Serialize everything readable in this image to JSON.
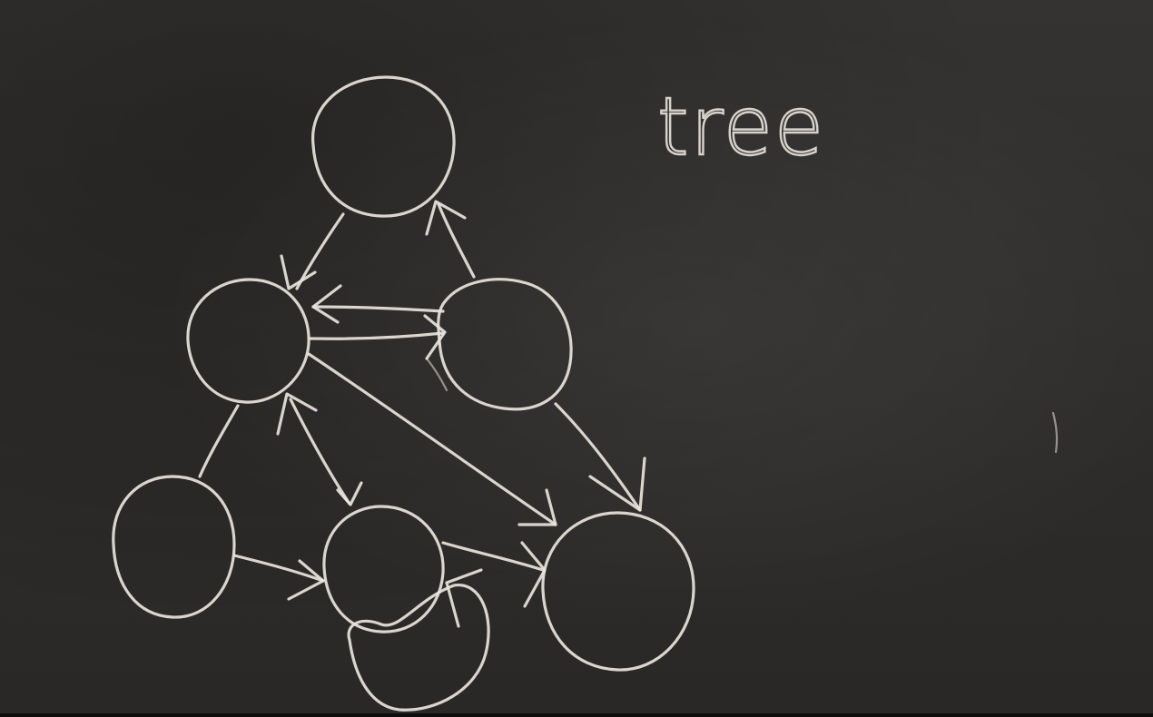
{
  "diagram": {
    "label": "tree",
    "chalk_color": "#e9e4dc",
    "board_color": "#2f2d2b",
    "nodes": [
      {
        "id": "n1"
      },
      {
        "id": "n2"
      },
      {
        "id": "n3"
      },
      {
        "id": "n4"
      },
      {
        "id": "n5"
      },
      {
        "id": "n6"
      },
      {
        "id": "n7"
      }
    ],
    "edges": [
      {
        "from": "n1",
        "to": "n2",
        "arrow": "to"
      },
      {
        "from": "n3",
        "to": "n1",
        "arrow": "to"
      },
      {
        "from": "n3",
        "to": "n2",
        "arrow": "to"
      },
      {
        "from": "n2",
        "to": "n3",
        "arrow": "to"
      },
      {
        "from": "n4",
        "to": "n2",
        "arrow": "none"
      },
      {
        "from": "n5",
        "to": "n2",
        "arrow": "to"
      },
      {
        "from": "n2",
        "to": "n5",
        "arrow": "to"
      },
      {
        "from": "n4",
        "to": "n5",
        "arrow": "to"
      },
      {
        "from": "n2",
        "to": "n6",
        "arrow": "to"
      },
      {
        "from": "n3",
        "to": "n6",
        "arrow": "to"
      },
      {
        "from": "n5",
        "to": "n6",
        "arrow": "to"
      },
      {
        "from": "n7",
        "to": "n5",
        "arrow": "to"
      }
    ]
  }
}
